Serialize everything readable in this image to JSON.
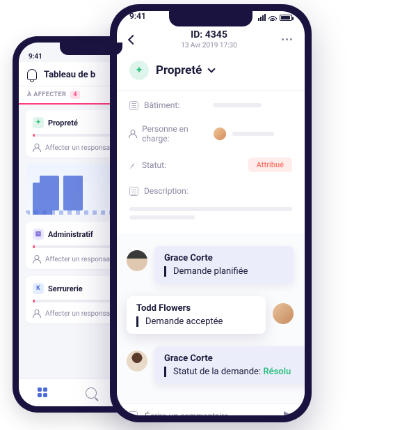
{
  "status_time": "9:41",
  "back_phone": {
    "header_title": "Tableau de b",
    "filter_label": "À AFFECTER",
    "filter_count": "4",
    "assign_label": "Affecter un responsab",
    "cards": [
      {
        "icon": "chip-green",
        "glyph": "✦",
        "title": "Propreté"
      },
      {
        "icon": "chip-purple",
        "glyph": "▤",
        "title": "Administratif"
      },
      {
        "icon": "chip-blue",
        "glyph": "K",
        "title": "Serrurerie"
      }
    ]
  },
  "front_phone": {
    "header": {
      "id_label": "ID: 4345",
      "datetime": "13 Avr 2019 17:30"
    },
    "category": {
      "name": "Propreté",
      "glyph": "✦"
    },
    "fields": {
      "building_label": "Bâtiment:",
      "person_label": "Personne en charge:",
      "status_label": "Statut:",
      "status_value": "Attribué",
      "description_label": "Description:"
    },
    "comments": [
      {
        "author": "Grace Corte",
        "text": "Demande planifiée",
        "accent": "accent-red",
        "type": "incoming"
      },
      {
        "author": "Todd Flowers",
        "text": "Demande acceptée",
        "accent": "accent-teal",
        "type": "outgoing"
      },
      {
        "author": "Grace Corte",
        "text": "Statut de la demande: ",
        "status_text": "Résolu",
        "accent": "accent-green",
        "type": "incoming-wide"
      }
    ],
    "composer_placeholder": "Écrire un commentaire.."
  }
}
